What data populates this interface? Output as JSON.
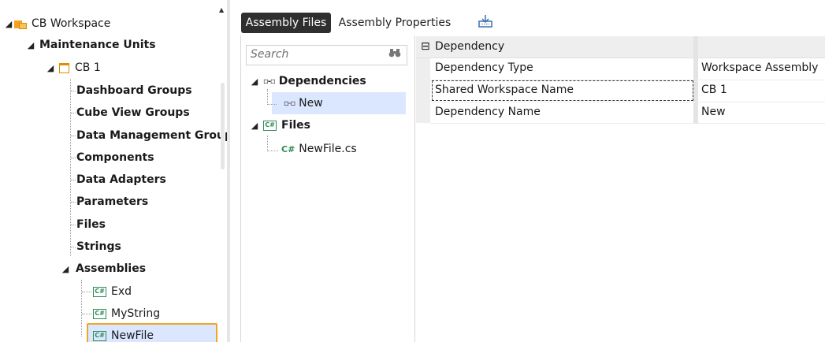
{
  "tree": {
    "workspace": "CB Workspace",
    "maintenance_units": "Maintenance Units",
    "unit": "CB 1",
    "groups": [
      "Dashboard Groups",
      "Cube View Groups",
      "Data Management Group",
      "Components",
      "Data Adapters",
      "Parameters",
      "Files",
      "Strings"
    ],
    "assemblies": "Assemblies",
    "assembly_items": [
      "Exd",
      "MyString",
      "NewFile"
    ]
  },
  "tabs": {
    "assembly_files": "Assembly Files",
    "assembly_properties": "Assembly Properties"
  },
  "files_panel": {
    "search_placeholder": "Search",
    "dependencies": "Dependencies",
    "dependency_item": "New",
    "files": "Files",
    "file_item": "NewFile.cs"
  },
  "property_grid": {
    "category": "Dependency",
    "rows": [
      {
        "name": "Dependency Type",
        "value": "Workspace Assembly"
      },
      {
        "name": "Shared Workspace Name",
        "value": "CB 1"
      },
      {
        "name": "Dependency Name",
        "value": "New"
      }
    ]
  },
  "icons": {
    "triangle": "▲",
    "collapse": "⊟",
    "binoculars": "binoculars-icon",
    "deploy": "deploy-icon"
  },
  "colors": {
    "selection": "#dbe7ff",
    "selection_border": "#f0a42a",
    "tab_active": "#2f2f2f"
  }
}
